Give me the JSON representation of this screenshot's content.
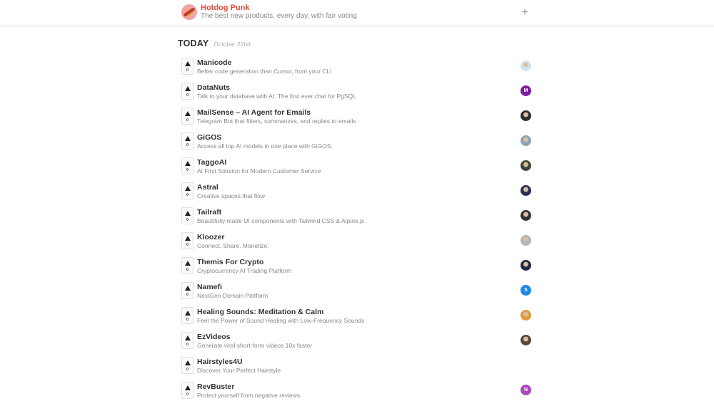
{
  "header": {
    "brand_title": "Hotdog Punk",
    "brand_tagline": "The best new products, every day, with fair voting",
    "add_label": "+"
  },
  "section": {
    "title": "TODAY",
    "date": "October 22nd"
  },
  "products": [
    {
      "name": "Manicode",
      "description": "Better code generation than Cursor, from your CLI",
      "votes": "0",
      "avatar": {
        "type": "photo",
        "color": "#cfe3ef",
        "initial": ""
      }
    },
    {
      "name": "DataNuts",
      "description": "Talk to your database with AI. The first ever chat for PgSQL",
      "votes": "0",
      "avatar": {
        "type": "letter",
        "color": "#7b1fa2",
        "initial": "M"
      }
    },
    {
      "name": "MailSense – AI Agent for Emails",
      "description": "Telegram Bot that filters, summarizes, and replies to emails",
      "votes": "0",
      "avatar": {
        "type": "photo",
        "color": "#2e2e2e",
        "initial": ""
      }
    },
    {
      "name": "GiGOS",
      "description": "Access all top AI models in one place with GiGOS.",
      "votes": "0",
      "avatar": {
        "type": "photo",
        "color": "#8aa4b8",
        "initial": ""
      }
    },
    {
      "name": "TaggoAI",
      "description": "AI First Solution for Modern Customer Service",
      "votes": "0",
      "avatar": {
        "type": "photo",
        "color": "#3a4a3a",
        "initial": ""
      }
    },
    {
      "name": "Astral",
      "description": "Creative spaces that flow",
      "votes": "0",
      "avatar": {
        "type": "photo",
        "color": "#2a2f55",
        "initial": ""
      }
    },
    {
      "name": "Tailraft",
      "description": "Beautifully made UI components with Tailwind CSS & Alpine.js",
      "votes": "0",
      "avatar": {
        "type": "photo",
        "color": "#333333",
        "initial": ""
      }
    },
    {
      "name": "Kloozer",
      "description": "Connect. Share. Monetize.",
      "votes": "0",
      "avatar": {
        "type": "photo",
        "color": "#b5b5b5",
        "initial": ""
      }
    },
    {
      "name": "Themis For Crypto",
      "description": "Cryptocurrency AI Trading Platform",
      "votes": "0",
      "avatar": {
        "type": "photo",
        "color": "#1f2b44",
        "initial": ""
      }
    },
    {
      "name": "Namefi",
      "description": "NextGen Domain Platform",
      "votes": "0",
      "avatar": {
        "type": "letter",
        "color": "#1e88e5",
        "initial": "S"
      }
    },
    {
      "name": "Healing Sounds: Meditation & Calm",
      "description": "Feel the Power of Sound Healing with Low-Frequency Sounds",
      "votes": "0",
      "avatar": {
        "type": "photo",
        "color": "#e09a3a",
        "initial": ""
      }
    },
    {
      "name": "EzVideos",
      "description": "Generate viral short-form videos 10x faster",
      "votes": "0",
      "avatar": {
        "type": "photo",
        "color": "#5a4a3a",
        "initial": ""
      }
    },
    {
      "name": "Hairstyles4U",
      "description": "Discover Your Perfect Hairstyle",
      "votes": "0",
      "avatar": {
        "type": "none",
        "color": "",
        "initial": ""
      }
    },
    {
      "name": "RevBuster",
      "description": "Protect yourself from negative reviews",
      "votes": "0",
      "avatar": {
        "type": "letter",
        "color": "#ab47bc",
        "initial": "N"
      }
    }
  ]
}
